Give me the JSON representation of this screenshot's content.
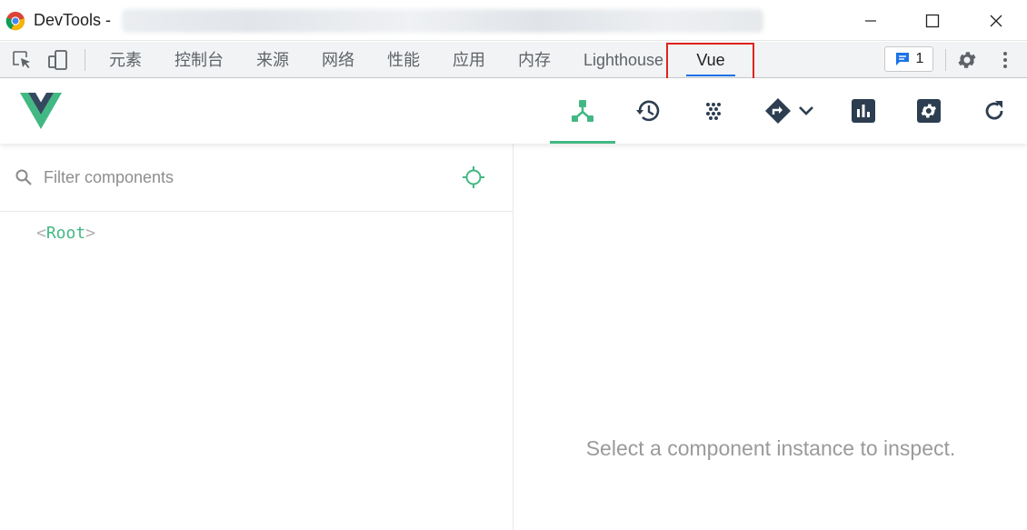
{
  "window": {
    "title": "DevTools -",
    "controls": [
      "minimize",
      "maximize",
      "close"
    ]
  },
  "devtools": {
    "tabs": [
      {
        "label": "元素"
      },
      {
        "label": "控制台"
      },
      {
        "label": "来源"
      },
      {
        "label": "网络"
      },
      {
        "label": "性能"
      },
      {
        "label": "应用"
      },
      {
        "label": "内存"
      },
      {
        "label": "Lighthouse"
      },
      {
        "label": "Vue",
        "active": true
      }
    ],
    "issues_count": "1"
  },
  "vue": {
    "toolbar": [
      "components-icon",
      "timeline-history-icon",
      "performance-dots-icon",
      "routing-icon",
      "vuex-chart-icon",
      "settings-icon",
      "refresh-icon"
    ],
    "active_tool": "components-icon",
    "accent": "#42b883",
    "filter": {
      "placeholder": "Filter components",
      "value": ""
    },
    "tree": [
      {
        "name": "Root"
      }
    ],
    "inspector": {
      "empty_message": "Select a component instance to inspect."
    }
  },
  "colors": {
    "highlight_box": "#e0231f",
    "active_tab_underline": "#1a73e8"
  }
}
